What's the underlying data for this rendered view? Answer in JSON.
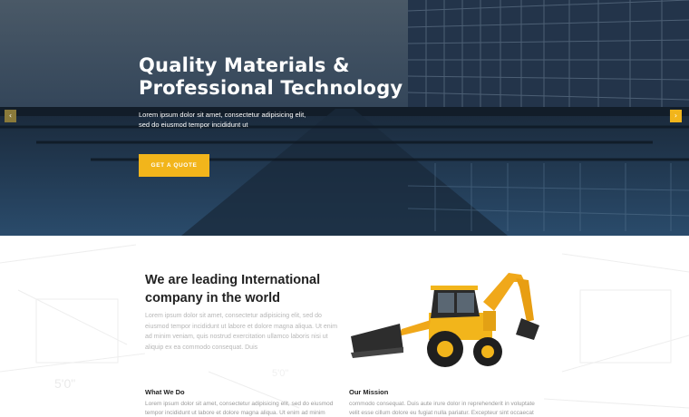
{
  "hero": {
    "title_line1": "Quality Materials &",
    "title_line2": "Professional Technology",
    "subtitle_line1": "Lorem ipsum dolor sit amet, consectetur adipisicing elit,",
    "subtitle_line2": "sed do eiusmod tempor incididunt ut",
    "cta_label": "GET A QUOTE",
    "prev_arrow": "‹",
    "next_arrow": "›"
  },
  "about": {
    "heading_line1": "We are leading International",
    "heading_line2": "company in the world",
    "body": "Lorem ipsum dolor sit amet, consectetur adipisicing elit, sed do eiusmod tempor incididunt ut labore et dolore magna aliqua. Ut enim ad minim veniam, quis nostrud exercitation ullamco laboris nisi ut aliquip ex ea commodo consequat. Duis",
    "columns": [
      {
        "title": "What We Do",
        "text": "Lorem ipsum dolor sit amet, consectetur adipisicing elit, sed do eiusmod tempor incididunt ut labore et dolore magna aliqua. Ut enim ad minim"
      },
      {
        "title": "Our Mission",
        "text": "commodo consequat. Duis aute irure dolor in reprehenderit in voluptate velit esse cillum dolore eu fugiat nulla pariatur. Excepteur sint occaecat"
      }
    ],
    "blueprint_dim_1": "5'0\"",
    "blueprint_dim_2": "5'0\""
  },
  "colors": {
    "accent": "#f2b51b",
    "hero_overlay": "#2f3f50",
    "heading_text": "#222222",
    "body_text": "#b7b7b7"
  },
  "icons": {
    "prev": "chevron-left-icon",
    "next": "chevron-right-icon"
  }
}
